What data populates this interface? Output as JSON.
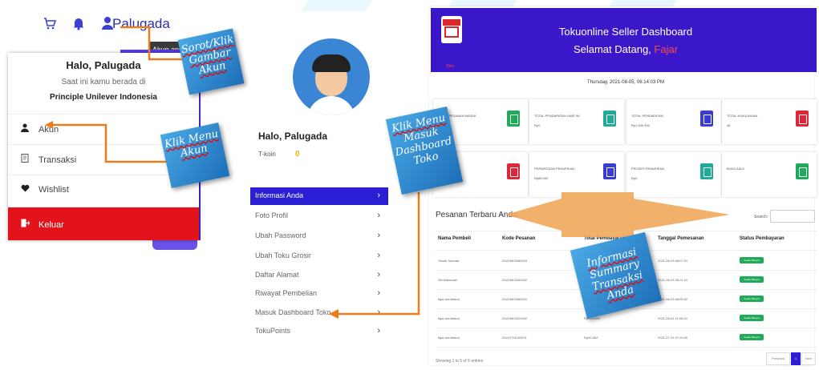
{
  "topnav": {
    "cart_icon": "cart-icon",
    "bell_icon": "bell-icon",
    "user_icon": "user-icon",
    "username": "Palugada",
    "tooltip": "Akun anda"
  },
  "dropdown": {
    "greeting": "Halo, Palugada",
    "location_line": "Saat ini kamu berada di",
    "location": "Principle Unilever Indonesia",
    "items": [
      {
        "icon": "user-icon",
        "label": "Akun"
      },
      {
        "icon": "receipt-icon",
        "label": "Transaksi"
      },
      {
        "icon": "heart-icon",
        "label": "Wishlist"
      },
      {
        "icon": "logout-icon",
        "label": "Keluar"
      }
    ]
  },
  "background_promo": "toko",
  "profile": {
    "greeting": "Halo, Palugada",
    "koin_label": "T-koin",
    "koin_value": "0",
    "menu": [
      "Informasi Anda",
      "Foto Profil",
      "Ubah Password",
      "Ubah Toku Grosir",
      "Daftar Alamat",
      "Riwayat Pembelian",
      "Masuk Dashboard Toko",
      "TokuPoints"
    ]
  },
  "dashboard": {
    "logo_text": "Toko",
    "title": "Tokuonline Seller Dashboard",
    "welcome": "Selamat Datang,",
    "welcome_name": "Fajar",
    "datetime": "Thursday, 2021-08-05, 06:14:03 PM",
    "stats": [
      {
        "label": "TOTAL PESANAN MASUK",
        "value": "",
        "color": "#1faa59"
      },
      {
        "label": "TOTAL PENDAPATAN HARI INI",
        "value": "Rp0",
        "color": "#1faa99"
      },
      {
        "label": "TOTAL PENDAPATAN",
        "value": "Rp1.530.500",
        "color": "#3a3ad4"
      },
      {
        "label": "TOTAL KUNJUNGAN",
        "value": "48",
        "color": "#e0243a"
      },
      {
        "label": "",
        "value": "",
        "color": "#e0243a"
      },
      {
        "label": "PERMINTAAN PENARIKAN",
        "value": "Rp85.000",
        "color": "#3a3ad4"
      },
      {
        "label": "PROSES PENARIKAN",
        "value": "Rp0",
        "color": "#1faa99"
      },
      {
        "label": "BUKA SALE",
        "value": "",
        "color": "#1faa59"
      }
    ],
    "orders_title": "Pesanan Terbaru Anda",
    "search_label": "Search:",
    "columns": [
      "Nama Pembeli",
      "Kode Pesanan",
      "Total Pembayaran",
      "Tanggal Pemesanan",
      "Status Pembayaran"
    ],
    "rows": [
      [
        "Yanah Subrata",
        "20210803480003",
        "",
        "2021-08-03 08:07:01",
        "Sudah Dibayar"
      ],
      [
        "Siti Markonah",
        "20210803340002",
        "",
        "2021-08-03 08:21:41",
        "Sudah Dibayar"
      ],
      [
        "fajar hendratno",
        "20210803380001",
        "",
        "2021-08-03 08:05:52",
        "Sudah Dibayar"
      ],
      [
        "fajar hendratno",
        "20210802020002",
        "Rp124.528",
        "2021-08-02 11:06:02",
        "Sudah Dibayar"
      ],
      [
        "fajar hendratno",
        "20210731162001",
        "Rp60.662",
        "2021-07-31 07:24:00",
        "Sudah Dibayar"
      ]
    ],
    "entries_text": "Showing 1 to 5 of 5 entries",
    "prev_label": "Previous",
    "page_label": "1",
    "next_label": "Next"
  },
  "callouts": {
    "c1_line1": "Sorot/Klik",
    "c1_line2": "Gambar Akun",
    "c2_line1": "Klik Menu",
    "c2_line2": "Akun",
    "c3_line1": "Klik Menu",
    "c3_line2": "Masuk",
    "c3_line3": "Dashboard",
    "c3_line4": "Toko",
    "c4_line1": "Informasi",
    "c4_line2": "Summary",
    "c4_line3": "Transaksi Anda"
  }
}
